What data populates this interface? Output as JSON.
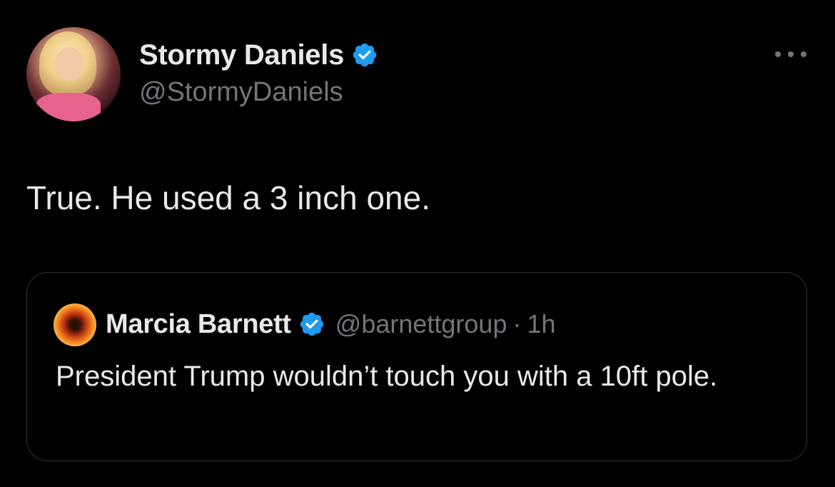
{
  "tweet": {
    "display_name": "Stormy Daniels",
    "handle": "@StormyDaniels",
    "verified": true,
    "more_icon": "more-horizontal-icon",
    "text": "True. He used a 3 inch one."
  },
  "quoted_tweet": {
    "display_name": "Marcia Barnett",
    "handle": "@barnettgroup",
    "separator": "·",
    "timestamp": "1h",
    "verified": true,
    "text": "President Trump wouldn’t touch you with a 10ft pole."
  },
  "colors": {
    "background": "#000000",
    "primary_text": "#e7e9ea",
    "secondary_text": "#71767b",
    "verified_badge": "#1d9bf0",
    "border": "#2f3336"
  }
}
